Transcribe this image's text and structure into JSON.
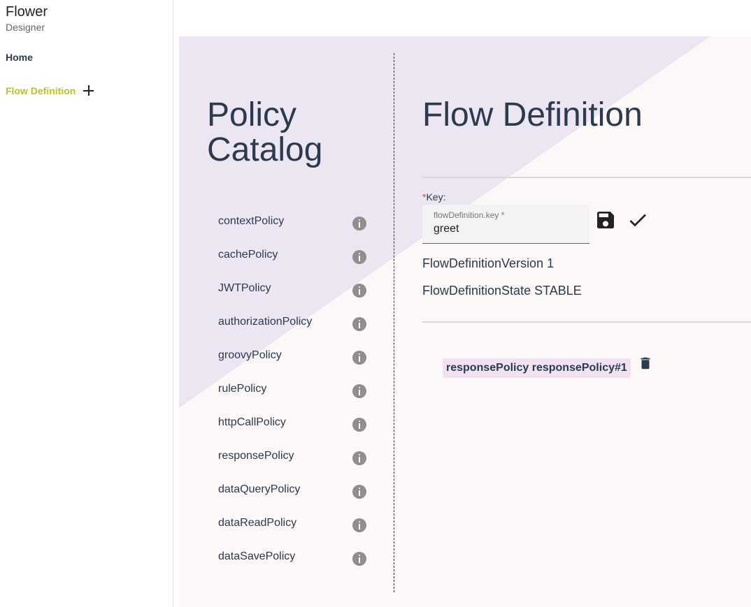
{
  "sidebar": {
    "app_title": "Flower",
    "app_subtitle": "Designer",
    "items": [
      {
        "label": "Home"
      },
      {
        "label": "Flow Definition"
      }
    ],
    "active_color": "#b8c42d"
  },
  "catalog": {
    "title_line1": "Policy",
    "title_line2": "Catalog",
    "policies": [
      "contextPolicy",
      "cachePolicy",
      "JWTPolicy",
      "authorizationPolicy",
      "groovyPolicy",
      "rulePolicy",
      "httpCallPolicy",
      "responsePolicy",
      "dataQueryPolicy",
      "dataReadPolicy",
      "dataSavePolicy"
    ]
  },
  "flow": {
    "title": "Flow Definition",
    "key_label": "Key:",
    "key_required_mark": "*",
    "key_field_label": "flowDefinition.key *",
    "key_value": "greet",
    "version_text": "FlowDefinitionVersion 1",
    "state_text": "FlowDefinitionState STABLE",
    "chip_text": "responsePolicy responsePolicy#1"
  },
  "icons": {
    "add": "plus-icon",
    "info": "info-icon",
    "save": "floppy-disk-icon",
    "confirm": "check-icon",
    "delete": "trash-icon"
  },
  "colors": {
    "text_primary": "#2c3a4d",
    "diagonal_accent": "#ece6f3",
    "panel_bg": "#fcf8f8",
    "chip_bg": "#f0e2f0"
  }
}
